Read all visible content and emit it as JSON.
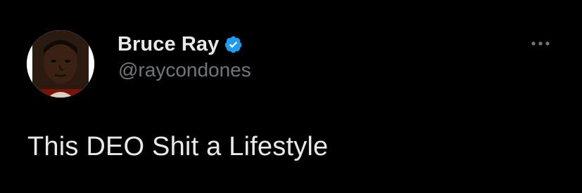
{
  "tweet": {
    "author": {
      "display_name": "Bruce Ray",
      "handle": "@raycondones",
      "verified": true,
      "avatar_icon": "profile-photo-avatar"
    },
    "text": "This DEO Shit a Lifestyle",
    "more_icon": "more-horizontal-icon"
  },
  "colors": {
    "background": "#000000",
    "primary_text": "#e7e9ea",
    "secondary_text": "#71767b",
    "verified_blue": "#1d9bf0"
  }
}
